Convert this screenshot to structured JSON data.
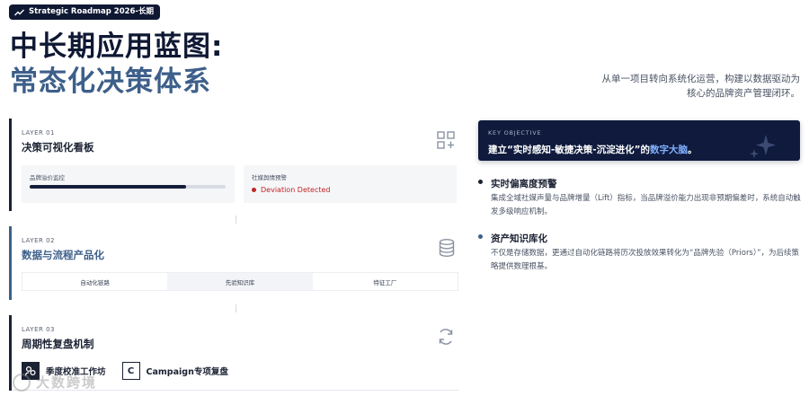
{
  "header": {
    "badge_label": "Strategic Roadmap 2026-长期",
    "title_line1": "中长期应用蓝图:",
    "title_line2": "常态化决策体系",
    "intro": "从单一项目转向系统化运营，构建以数据驱动为核心的品牌资产管理闭环。"
  },
  "layers": [
    {
      "tag": "LAYER 01",
      "title": "决策可视化看板",
      "icon": "dashboard-grid-icon",
      "panels": [
        {
          "label": "品牌溢价监控",
          "progress": 0.8
        },
        {
          "label": "社媒舆情预警",
          "status": "Deviation Detected"
        }
      ]
    },
    {
      "tag": "LAYER 02",
      "title": "数据与流程产品化",
      "icon": "database-icon",
      "steps": [
        "自动化链路",
        "先验知识库",
        "特征工厂"
      ],
      "active_step": 1
    },
    {
      "tag": "LAYER 03",
      "title": "周期性复盘机制",
      "icon": "refresh-cycle-icon",
      "tools": [
        {
          "letter": "",
          "label": "季度校准工作坊"
        },
        {
          "letter": "C",
          "label": "Campaign专项复盘"
        }
      ]
    }
  ],
  "objective": {
    "tag": "KEY OBJECTIVE",
    "text_prefix": "建立“实时感知-敏捷决策-沉淀进化”的",
    "text_highlight": "数字大脑",
    "text_suffix": "。"
  },
  "features": [
    {
      "title": "实时偏离度预警",
      "body": "集成全域社媒声量与品牌增量（Lift）指标，当品牌溢价能力出现非预期偏差时，系统自动触发多级响应机制。",
      "bullet_color": "#1b2233"
    },
    {
      "title": "资产知识库化",
      "body": "不仅是存储数据，更通过自动化链路将历次投放效果转化为“品牌先验（Priors）”，为后续策略提供数理根基。",
      "bullet_color": "#3d5f8a"
    }
  ],
  "watermark": "大数跨境",
  "colors": {
    "navy": "#0f1833",
    "accent_blue": "#3d5f8a",
    "highlight": "#7fb0ff",
    "alert_red": "#c02626"
  }
}
